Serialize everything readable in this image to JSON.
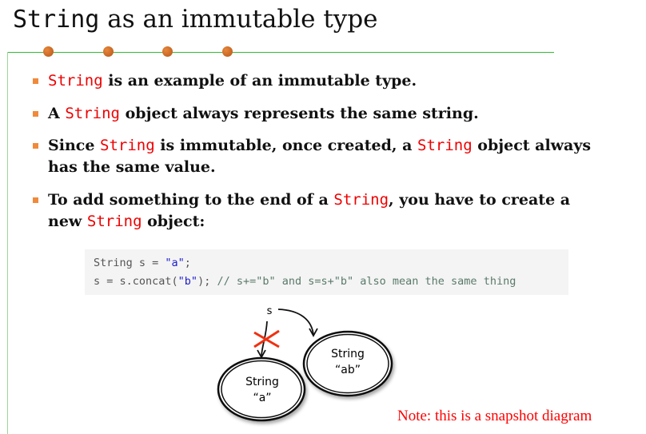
{
  "title": {
    "code": "String",
    "rest": " as an immutable type"
  },
  "bullets": [
    {
      "parts": [
        "",
        "String",
        " is an example of an immutable type."
      ]
    },
    {
      "parts": [
        "A ",
        "String",
        " object always represents the same string."
      ]
    },
    {
      "parts": [
        "Since ",
        "String",
        " is immutable, once created, a ",
        "String",
        " object always has the same value."
      ]
    },
    {
      "parts": [
        "To add something to the end of a ",
        "String",
        ", you have to create a new ",
        "String",
        " object:"
      ]
    }
  ],
  "code": {
    "line1": {
      "a": "String s = ",
      "s": "\"a\"",
      "b": ";"
    },
    "line2": {
      "a": "s = s.concat(",
      "s": "\"b\"",
      "b": "); ",
      "c": "// s+=\"b\" and s=s+\"b\" also mean the same thing"
    }
  },
  "diagram": {
    "var": "s",
    "obj1": {
      "type": "String",
      "value": "“a”"
    },
    "obj2": {
      "type": "String",
      "value": "“ab”"
    }
  },
  "note": "Note: this is a snapshot diagram",
  "colors": {
    "accent": "#f08a3a",
    "keyword": "#ee0000",
    "rule": "#33bb33"
  }
}
